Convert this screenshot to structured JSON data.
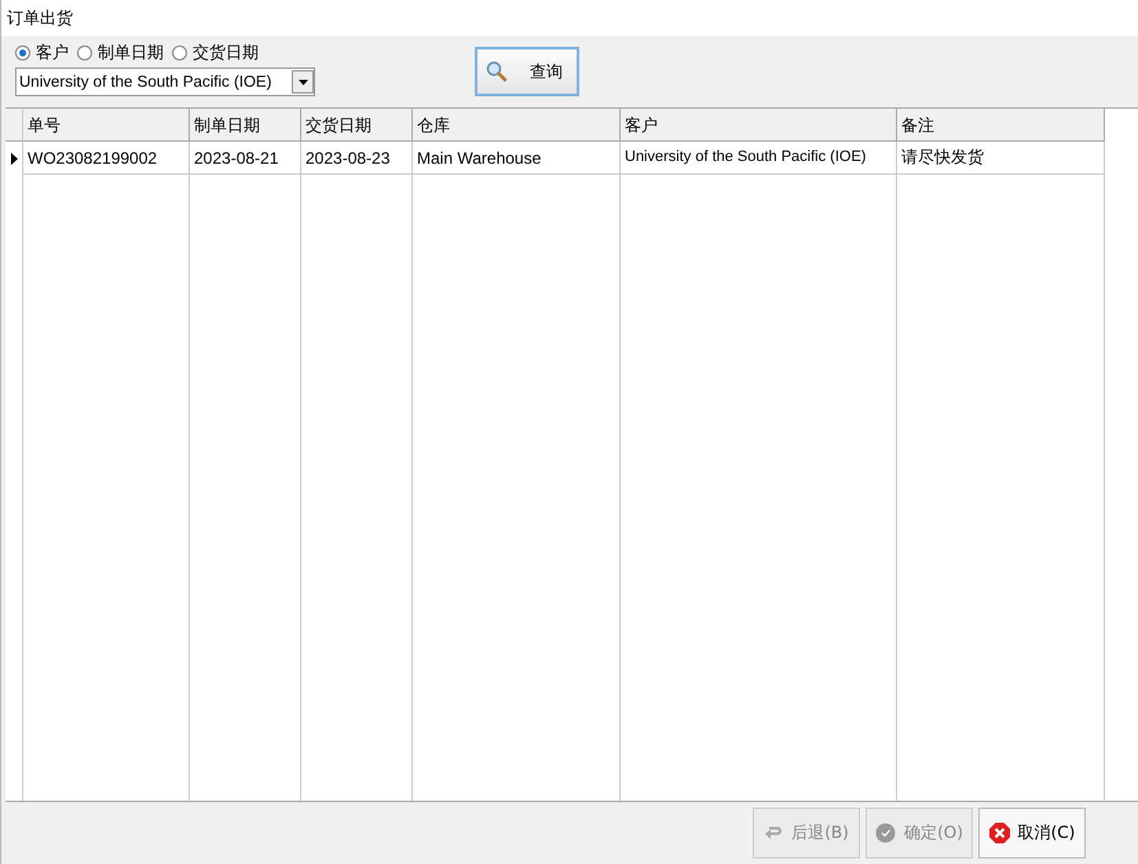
{
  "window": {
    "title": "订单出货"
  },
  "filter": {
    "options": [
      {
        "label": "客户",
        "selected": true
      },
      {
        "label": "制单日期",
        "selected": false
      },
      {
        "label": "交货日期",
        "selected": false
      }
    ],
    "customer": {
      "value": "University of the South Pacific (IOE)"
    },
    "query_button": "查询"
  },
  "table": {
    "columns": [
      "单号",
      "制单日期",
      "交货日期",
      "仓库",
      "客户",
      "备注"
    ],
    "rows": [
      {
        "selected": true,
        "cells": [
          "WO23082199002",
          "2023-08-21",
          "2023-08-23",
          "Main Warehouse",
          "University of the South Pacific (IOE)",
          "请尽快发货"
        ]
      }
    ]
  },
  "buttons": [
    {
      "kind": "back",
      "label": "后退(B)",
      "disabled": true
    },
    {
      "kind": "confirm",
      "label": "确定(O)",
      "disabled": true
    },
    {
      "kind": "cancel",
      "label": "取消(C)",
      "disabled": false
    }
  ]
}
